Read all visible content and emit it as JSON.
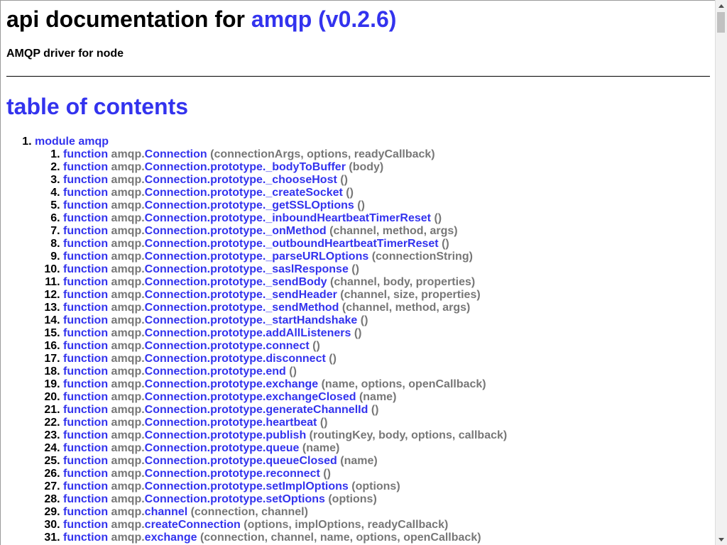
{
  "header": {
    "title_prefix": "api documentation for ",
    "project": "amqp (v0.2.6)",
    "description": "AMQP driver for node"
  },
  "toc": {
    "heading": "table of contents",
    "module_label": "module amqp",
    "functions": [
      {
        "keyword": "function",
        "ns": "amqp.",
        "name": "Connection",
        "args": "(connectionArgs, options, readyCallback)"
      },
      {
        "keyword": "function",
        "ns": "amqp.",
        "name": "Connection.prototype._bodyToBuffer",
        "args": "(body)"
      },
      {
        "keyword": "function",
        "ns": "amqp.",
        "name": "Connection.prototype._chooseHost",
        "args": "()"
      },
      {
        "keyword": "function",
        "ns": "amqp.",
        "name": "Connection.prototype._createSocket",
        "args": "()"
      },
      {
        "keyword": "function",
        "ns": "amqp.",
        "name": "Connection.prototype._getSSLOptions",
        "args": "()"
      },
      {
        "keyword": "function",
        "ns": "amqp.",
        "name": "Connection.prototype._inboundHeartbeatTimerReset",
        "args": "()"
      },
      {
        "keyword": "function",
        "ns": "amqp.",
        "name": "Connection.prototype._onMethod",
        "args": "(channel, method, args)"
      },
      {
        "keyword": "function",
        "ns": "amqp.",
        "name": "Connection.prototype._outboundHeartbeatTimerReset",
        "args": "()"
      },
      {
        "keyword": "function",
        "ns": "amqp.",
        "name": "Connection.prototype._parseURLOptions",
        "args": "(connectionString)"
      },
      {
        "keyword": "function",
        "ns": "amqp.",
        "name": "Connection.prototype._saslResponse",
        "args": "()"
      },
      {
        "keyword": "function",
        "ns": "amqp.",
        "name": "Connection.prototype._sendBody",
        "args": "(channel, body, properties)"
      },
      {
        "keyword": "function",
        "ns": "amqp.",
        "name": "Connection.prototype._sendHeader",
        "args": "(channel, size, properties)"
      },
      {
        "keyword": "function",
        "ns": "amqp.",
        "name": "Connection.prototype._sendMethod",
        "args": "(channel, method, args)"
      },
      {
        "keyword": "function",
        "ns": "amqp.",
        "name": "Connection.prototype._startHandshake",
        "args": "()"
      },
      {
        "keyword": "function",
        "ns": "amqp.",
        "name": "Connection.prototype.addAllListeners",
        "args": "()"
      },
      {
        "keyword": "function",
        "ns": "amqp.",
        "name": "Connection.prototype.connect",
        "args": "()"
      },
      {
        "keyword": "function",
        "ns": "amqp.",
        "name": "Connection.prototype.disconnect",
        "args": "()"
      },
      {
        "keyword": "function",
        "ns": "amqp.",
        "name": "Connection.prototype.end",
        "args": "()"
      },
      {
        "keyword": "function",
        "ns": "amqp.",
        "name": "Connection.prototype.exchange",
        "args": "(name, options, openCallback)"
      },
      {
        "keyword": "function",
        "ns": "amqp.",
        "name": "Connection.prototype.exchangeClosed",
        "args": "(name)"
      },
      {
        "keyword": "function",
        "ns": "amqp.",
        "name": "Connection.prototype.generateChannelId",
        "args": "()"
      },
      {
        "keyword": "function",
        "ns": "amqp.",
        "name": "Connection.prototype.heartbeat",
        "args": "()"
      },
      {
        "keyword": "function",
        "ns": "amqp.",
        "name": "Connection.prototype.publish",
        "args": "(routingKey, body, options, callback)"
      },
      {
        "keyword": "function",
        "ns": "amqp.",
        "name": "Connection.prototype.queue",
        "args": "(name)"
      },
      {
        "keyword": "function",
        "ns": "amqp.",
        "name": "Connection.prototype.queueClosed",
        "args": "(name)"
      },
      {
        "keyword": "function",
        "ns": "amqp.",
        "name": "Connection.prototype.reconnect",
        "args": "()"
      },
      {
        "keyword": "function",
        "ns": "amqp.",
        "name": "Connection.prototype.setImplOptions",
        "args": "(options)"
      },
      {
        "keyword": "function",
        "ns": "amqp.",
        "name": "Connection.prototype.setOptions",
        "args": "(options)"
      },
      {
        "keyword": "function",
        "ns": "amqp.",
        "name": "channel",
        "args": "(connection, channel)"
      },
      {
        "keyword": "function",
        "ns": "amqp.",
        "name": "createConnection",
        "args": "(options, implOptions, readyCallback)"
      },
      {
        "keyword": "function",
        "ns": "amqp.",
        "name": "exchange",
        "args": "(connection, channel, name, options, openCallback)"
      }
    ]
  },
  "colors": {
    "link": "#3333ee",
    "muted": "#777777",
    "text": "#000000"
  },
  "icons": {
    "scroll_up": "triangle-up-icon",
    "scroll_down": "triangle-down-icon"
  }
}
